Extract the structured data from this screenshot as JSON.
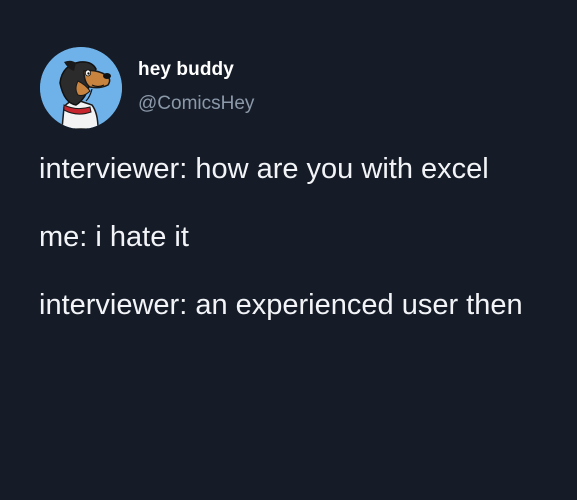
{
  "post": {
    "author": {
      "display_name": "hey buddy",
      "handle": "@ComicsHey",
      "avatar_icon": "cartoon-dog-avatar-icon"
    },
    "paragraphs": [
      "interviewer: how are you with excel",
      "me: i hate it",
      "interviewer: an experienced user then"
    ]
  },
  "colors": {
    "background": "#151c28",
    "text": "#f2f4f7",
    "handle": "#8b98a8",
    "avatar_bg": "#6fb2ea"
  }
}
